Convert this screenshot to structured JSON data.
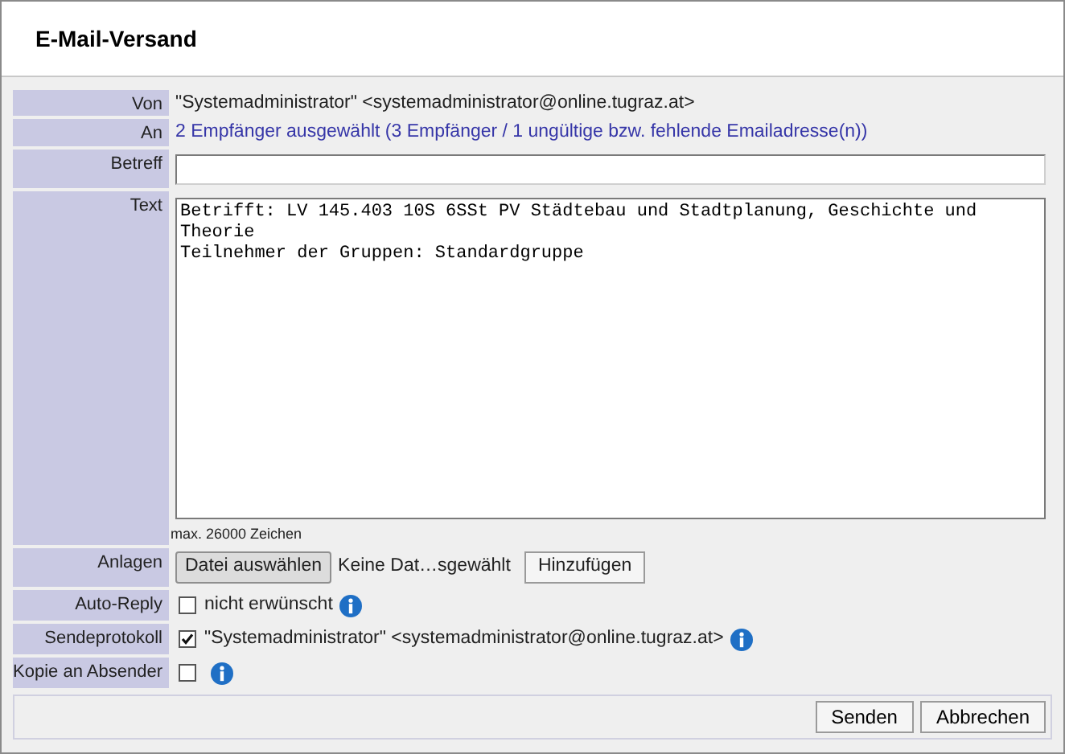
{
  "window": {
    "title": "E-Mail-Versand"
  },
  "rows": [
    {
      "kind": "text",
      "label": "Von",
      "value": "\"Systemadministrator\" <systemadministrator@online.tugraz.at>"
    },
    {
      "kind": "link",
      "label": "An",
      "value": "2 Empfänger ausgewählt (3 Empfänger / 1 ungültige bzw. fehlende Emailadresse(n))"
    },
    {
      "kind": "input",
      "label": "Betreff"
    },
    {
      "kind": "textarea",
      "label": "Text",
      "value": "Betrifft: LV 145.403 10S 6SSt PV Städtebau und Stadtplanung, Geschichte und Theorie\nTeilnehmer der Gruppen: Standardgruppe",
      "hint": "max. 26000 Zeichen"
    },
    {
      "kind": "file",
      "label": "Anlagen",
      "choose": "Datei auswählen",
      "status": "Keine Dat…sgewählt",
      "add": "Hinzufügen"
    },
    {
      "kind": "checkbox",
      "label": "Auto-Reply",
      "checked": false,
      "text": "nicht erwünscht",
      "info": true
    },
    {
      "kind": "checkbox",
      "label": "Sendeprotokoll",
      "checked": true,
      "text": "\"Systemadministrator\" <systemadministrator@online.tugraz.at>",
      "info": true
    },
    {
      "kind": "checkbox",
      "label": "Kopie an Absender",
      "checked": false,
      "info": true
    }
  ],
  "buttons": [
    "Senden",
    "Abbrechen"
  ]
}
